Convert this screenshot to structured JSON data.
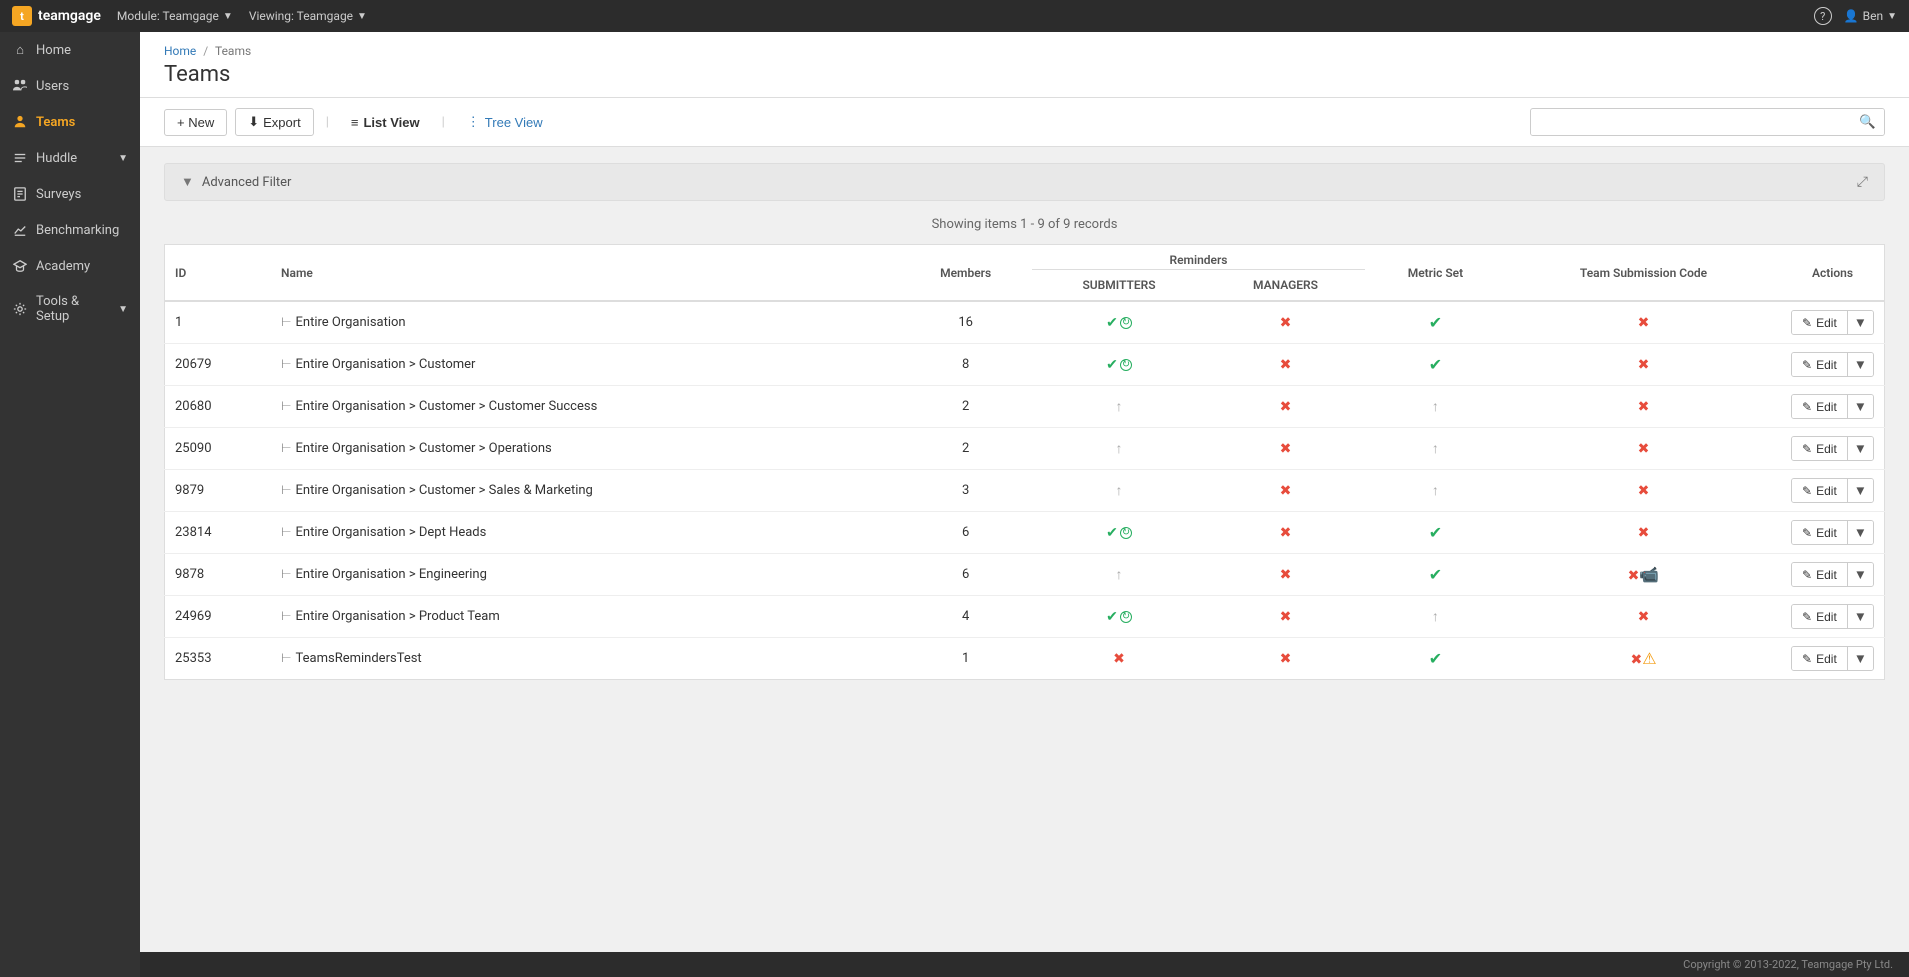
{
  "topnav": {
    "logo_text": "teamgage",
    "logo_letter": "t",
    "module_label": "Module: Teamgage",
    "viewing_label": "Viewing: Teamgage",
    "help_icon": "?",
    "user_label": "Ben"
  },
  "sidebar": {
    "items": [
      {
        "id": "home",
        "label": "Home",
        "icon": "⌂",
        "active": false
      },
      {
        "id": "users",
        "label": "Users",
        "icon": "👤",
        "active": false
      },
      {
        "id": "teams",
        "label": "Teams",
        "icon": "👥",
        "active": true
      },
      {
        "id": "huddle",
        "label": "Huddle",
        "icon": "≡",
        "active": false,
        "has_caret": true
      },
      {
        "id": "surveys",
        "label": "Surveys",
        "icon": "✎",
        "active": false
      },
      {
        "id": "benchmarking",
        "label": "Benchmarking",
        "icon": "📊",
        "active": false
      },
      {
        "id": "academy",
        "label": "Academy",
        "icon": "🎓",
        "active": false
      },
      {
        "id": "tools",
        "label": "Tools & Setup",
        "icon": "⚙",
        "active": false,
        "has_caret": true
      }
    ]
  },
  "breadcrumb": {
    "home": "Home",
    "current": "Teams",
    "separator": "/"
  },
  "page": {
    "title": "Teams"
  },
  "toolbar": {
    "new_label": "+ New",
    "export_label": "Export",
    "list_view_label": "List View",
    "tree_view_label": "Tree View",
    "search_placeholder": ""
  },
  "filter": {
    "label": "Advanced Filter",
    "expand_icon": "⤢"
  },
  "table": {
    "showing_info": "Showing items 1 - 9 of 9 records",
    "columns": {
      "id": "ID",
      "name": "Name",
      "members": "Members",
      "reminders": "Reminders",
      "submitters": "SUBMITTERS",
      "managers": "MANAGERS",
      "metric_set": "Metric Set",
      "team_submission_code": "Team Submission Code",
      "actions": "Actions"
    },
    "rows": [
      {
        "id": "1",
        "name": "Entire Organisation",
        "members": "16",
        "submitters": "check_notify",
        "managers": "x",
        "metric_set": "check",
        "team_submission_code": "x",
        "extra": "",
        "actions": "Edit"
      },
      {
        "id": "20679",
        "name": "Entire Organisation > Customer",
        "members": "8",
        "submitters": "check_notify",
        "managers": "x",
        "metric_set": "check",
        "team_submission_code": "x",
        "extra": "",
        "actions": "Edit"
      },
      {
        "id": "20680",
        "name": "Entire Organisation > Customer > Customer Success",
        "members": "2",
        "submitters": "inherit",
        "managers": "x",
        "metric_set": "inherit",
        "team_submission_code": "x",
        "extra": "",
        "actions": "Edit"
      },
      {
        "id": "25090",
        "name": "Entire Organisation > Customer > Operations",
        "members": "2",
        "submitters": "inherit",
        "managers": "x",
        "metric_set": "inherit",
        "team_submission_code": "x",
        "extra": "",
        "actions": "Edit"
      },
      {
        "id": "9879",
        "name": "Entire Organisation > Customer > Sales & Marketing",
        "members": "3",
        "submitters": "inherit",
        "managers": "x",
        "metric_set": "inherit",
        "team_submission_code": "x",
        "extra": "",
        "actions": "Edit"
      },
      {
        "id": "23814",
        "name": "Entire Organisation > Dept Heads",
        "members": "6",
        "submitters": "check_notify",
        "managers": "x",
        "metric_set": "check",
        "team_submission_code": "x",
        "extra": "",
        "actions": "Edit"
      },
      {
        "id": "9878",
        "name": "Entire Organisation > Engineering",
        "members": "6",
        "submitters": "inherit",
        "managers": "x",
        "metric_set": "check",
        "team_submission_code": "x",
        "extra": "video",
        "actions": "Edit"
      },
      {
        "id": "24969",
        "name": "Entire Organisation > Product Team",
        "members": "4",
        "submitters": "check_notify",
        "managers": "x",
        "metric_set": "inherit",
        "team_submission_code": "x",
        "extra": "",
        "actions": "Edit"
      },
      {
        "id": "25353",
        "name": "TeamsRemindersTest",
        "members": "1",
        "submitters": "x",
        "managers": "x",
        "metric_set": "check",
        "team_submission_code": "x",
        "extra": "warning",
        "actions": "Edit"
      }
    ]
  },
  "footer": {
    "copyright": "Copyright © 2013-2022, Teamgage Pty Ltd."
  }
}
